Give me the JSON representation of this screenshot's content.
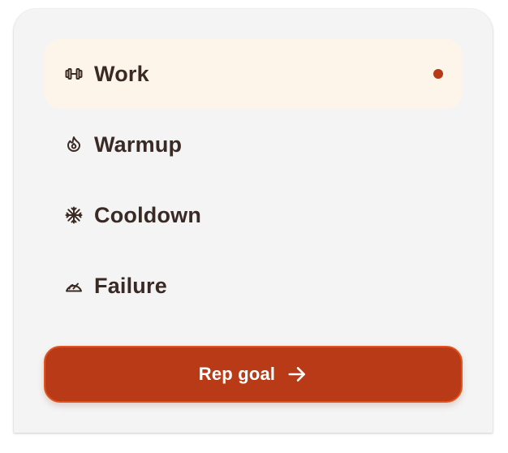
{
  "menu": {
    "items": [
      {
        "label": "Work",
        "icon": "dumbbell-icon",
        "selected": true
      },
      {
        "label": "Warmup",
        "icon": "flame-icon",
        "selected": false
      },
      {
        "label": "Cooldown",
        "icon": "snowflake-icon",
        "selected": false
      },
      {
        "label": "Failure",
        "icon": "gauge-icon",
        "selected": false
      }
    ]
  },
  "cta": {
    "label": "Rep goal",
    "icon": "arrow-right-icon"
  },
  "colors": {
    "accent": "#b83a16",
    "selected_bg": "#fdf4ea",
    "card_bg": "#f4f4f4",
    "text": "#3a2a25"
  }
}
